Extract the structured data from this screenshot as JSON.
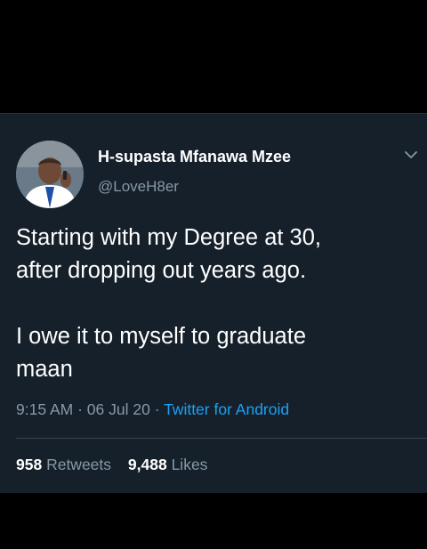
{
  "tweet": {
    "display_name": "H-supasta Mfanawa Mzee",
    "handle": "@LoveH8er",
    "avatar_icon": "user-avatar-photo",
    "more_icon": "chevron-down-icon",
    "text_lines": [
      "Starting with my Degree at 30,",
      "after dropping out years ago.",
      "",
      "I owe it to myself to graduate",
      "maan"
    ],
    "time": "9:15 AM",
    "separator": "·",
    "date": "06 Jul 20",
    "source": "Twitter for Android",
    "retweets": {
      "count": "958",
      "label": "Retweets"
    },
    "likes": {
      "count": "9,488",
      "label": "Likes"
    }
  },
  "colors": {
    "background": "#000000",
    "card": "#15202b",
    "text": "#ffffff",
    "secondary": "#8899a6",
    "link": "#1da1f2",
    "divider": "#38444d"
  }
}
